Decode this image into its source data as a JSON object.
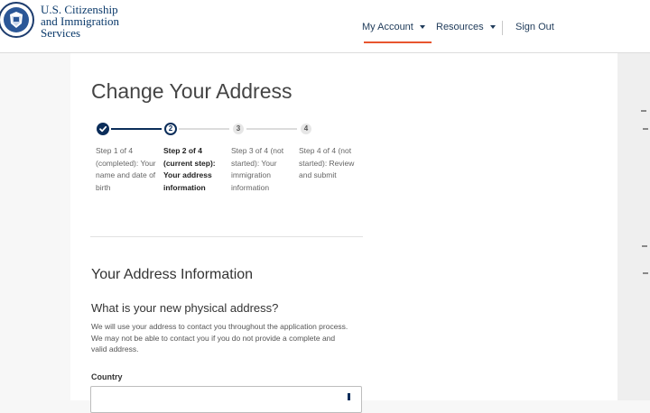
{
  "header": {
    "agency_line1": "U.S. Citizenship",
    "agency_line2": "and Immigration",
    "agency_line3": "Services",
    "seal_icon": "dhs-seal-icon",
    "nav": {
      "my_account": "My Account",
      "resources": "Resources",
      "sign_out": "Sign Out"
    },
    "accent_color": "#e8552e"
  },
  "page": {
    "title": "Change Your Address"
  },
  "steps": [
    {
      "marker": "",
      "status": "completed",
      "label": "Step 1 of 4 (completed): Your name and date of birth"
    },
    {
      "marker": "2",
      "status": "current",
      "label": "Step 2 of 4 (current step): Your address information"
    },
    {
      "marker": "3",
      "status": "not started",
      "label": "Step 3 of 4 (not started): Your immigration information"
    },
    {
      "marker": "4",
      "status": "not started",
      "label": "Step 4 of 4 (not started): Review and submit"
    }
  ],
  "section": {
    "title": "Your Address Information",
    "question": "What is your new physical address?",
    "help_text": "We will use your address to contact you throughout the application process. We may not be able to contact you if you do not provide a complete and valid address.",
    "country_label": "Country",
    "country_value": ""
  }
}
